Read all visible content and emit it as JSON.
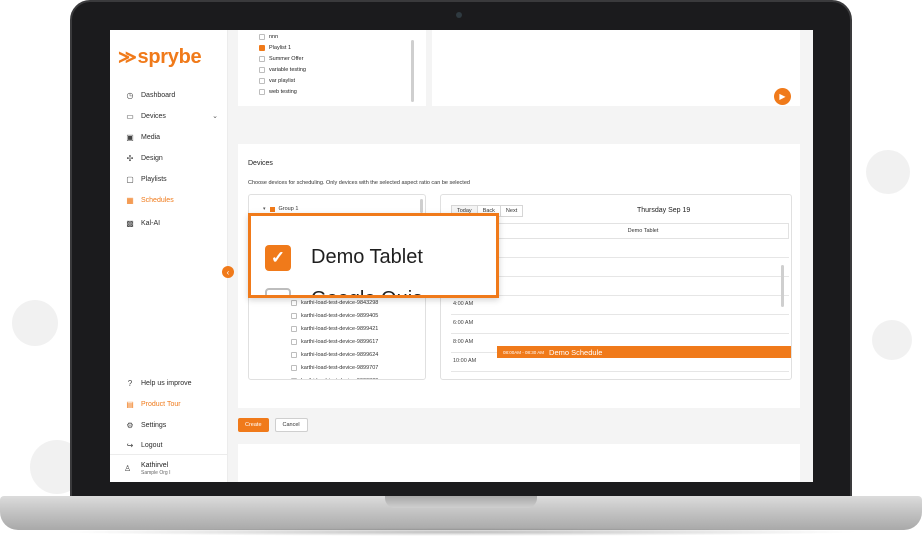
{
  "brand": {
    "name": "sprybe",
    "accent": "#f07a1a"
  },
  "sidebar": {
    "items": [
      {
        "label": "Dashboard",
        "icon": "clock-icon"
      },
      {
        "label": "Devices",
        "icon": "devices-icon"
      },
      {
        "label": "Media",
        "icon": "media-icon"
      },
      {
        "label": "Design",
        "icon": "design-icon"
      },
      {
        "label": "Playlists",
        "icon": "playlist-icon"
      },
      {
        "label": "Schedules",
        "icon": "calendar-icon",
        "active": true
      },
      {
        "label": "Kal-AI",
        "icon": "ai-icon"
      }
    ],
    "bottom_items": [
      {
        "label": "Help us improve",
        "icon": "help-icon"
      },
      {
        "label": "Product Tour",
        "icon": "tour-icon"
      },
      {
        "label": "Settings",
        "icon": "gear-icon"
      },
      {
        "label": "Logout",
        "icon": "logout-icon"
      }
    ],
    "user": {
      "name": "Kathirvel",
      "org": "Sample Org I"
    }
  },
  "playlists": [
    {
      "label": "nnn",
      "checked": false
    },
    {
      "label": "Playlist 1",
      "checked": true
    },
    {
      "label": "Summer Offer",
      "checked": false
    },
    {
      "label": "variable testing",
      "checked": false
    },
    {
      "label": "var playlist",
      "checked": false
    },
    {
      "label": "web testing",
      "checked": false
    }
  ],
  "devices": {
    "title": "Devices",
    "description": "Choose devices for scheduling. Only devices with the selected aspect ratio can be selected",
    "group": "Group 1",
    "list": [
      "karthi-load-test-device-9843298",
      "karthi-load-test-device-9899405",
      "karthi-load-test-device-9899421",
      "karthi-load-test-device-9899617",
      "karthi-load-test-device-9899624",
      "karthi-load-test-device-9899707",
      "karthi-load-test-device-9909309"
    ]
  },
  "calendar": {
    "buttons": {
      "today": "Today",
      "back": "Back",
      "next": "Next"
    },
    "date": "Thursday Sep 19",
    "column": "Demo Tablet",
    "times": [
      "4:00 AM",
      "6:00 AM",
      "8:00 AM",
      "10:00 AM"
    ],
    "event": {
      "time": "08:00AM - 08:30 AM",
      "title": "Demo Schedule"
    }
  },
  "actions": {
    "create": "Create",
    "cancel": "Cancel"
  },
  "zoom": {
    "selected": "Demo Tablet",
    "next": "Google Ouja..."
  }
}
